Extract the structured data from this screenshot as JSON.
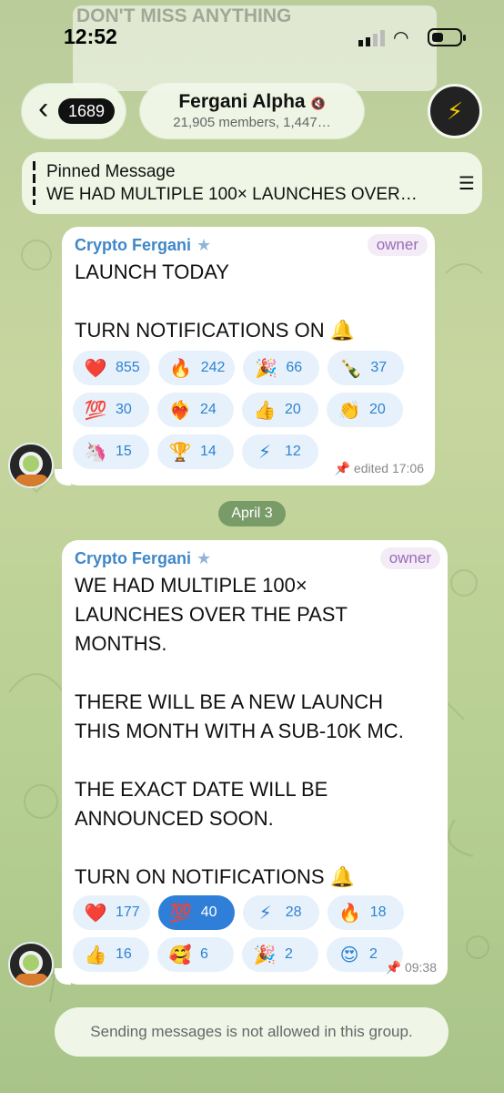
{
  "status": {
    "time": "12:52"
  },
  "background_banner": {
    "title": "DON'T MISS ANYTHING"
  },
  "header": {
    "back_count": "1689",
    "chat_title": "Fergani Alpha",
    "chat_subtitle": "21,905 members, 1,447…",
    "muted_icon": "mute-icon"
  },
  "pinned": {
    "label": "Pinned Message",
    "text": "WE HAD MULTIPLE 100× LAUNCHES OVER…"
  },
  "messages": [
    {
      "sender": "Crypto Fergani",
      "role": "owner",
      "text": "LAUNCH TODAY\n\nTURN NOTIFICATIONS ON 🔔",
      "reactions": [
        {
          "emoji": "❤️",
          "count": "855"
        },
        {
          "emoji": "🔥",
          "count": "242"
        },
        {
          "emoji": "🎉",
          "count": "66"
        },
        {
          "emoji": "🍾",
          "count": "37"
        },
        {
          "emoji": "💯",
          "count": "30"
        },
        {
          "emoji": "❤️‍🔥",
          "count": "24"
        },
        {
          "emoji": "👍",
          "count": "20"
        },
        {
          "emoji": "👏",
          "count": "20"
        },
        {
          "emoji": "🦄",
          "count": "15"
        },
        {
          "emoji": "🏆",
          "count": "14"
        },
        {
          "emoji": "⚡",
          "count": "12"
        }
      ],
      "meta": "edited 17:06"
    },
    {
      "sender": "Crypto Fergani",
      "role": "owner",
      "text": "WE HAD MULTIPLE 100×\nLAUNCHES OVER THE PAST\nMONTHS.\n\nTHERE WILL BE A NEW LAUNCH\nTHIS MONTH WITH A SUB-10K MC.\n\nTHE EXACT DATE WILL BE\nANNOUNCED SOON.\n\nTURN ON NOTIFICATIONS 🔔",
      "reactions": [
        {
          "emoji": "❤️",
          "count": "177"
        },
        {
          "emoji": "💯",
          "count": "40"
        },
        {
          "emoji": "⚡",
          "count": "28"
        },
        {
          "emoji": "🔥",
          "count": "18"
        },
        {
          "emoji": "👍",
          "count": "16"
        },
        {
          "emoji": "🥰",
          "count": "6"
        },
        {
          "emoji": "🎉",
          "count": "2"
        },
        {
          "emoji": "😍",
          "count": "2"
        }
      ],
      "meta": "09:38"
    }
  ],
  "date_separator": "April 3",
  "footer": "Sending messages is not allowed in this group."
}
